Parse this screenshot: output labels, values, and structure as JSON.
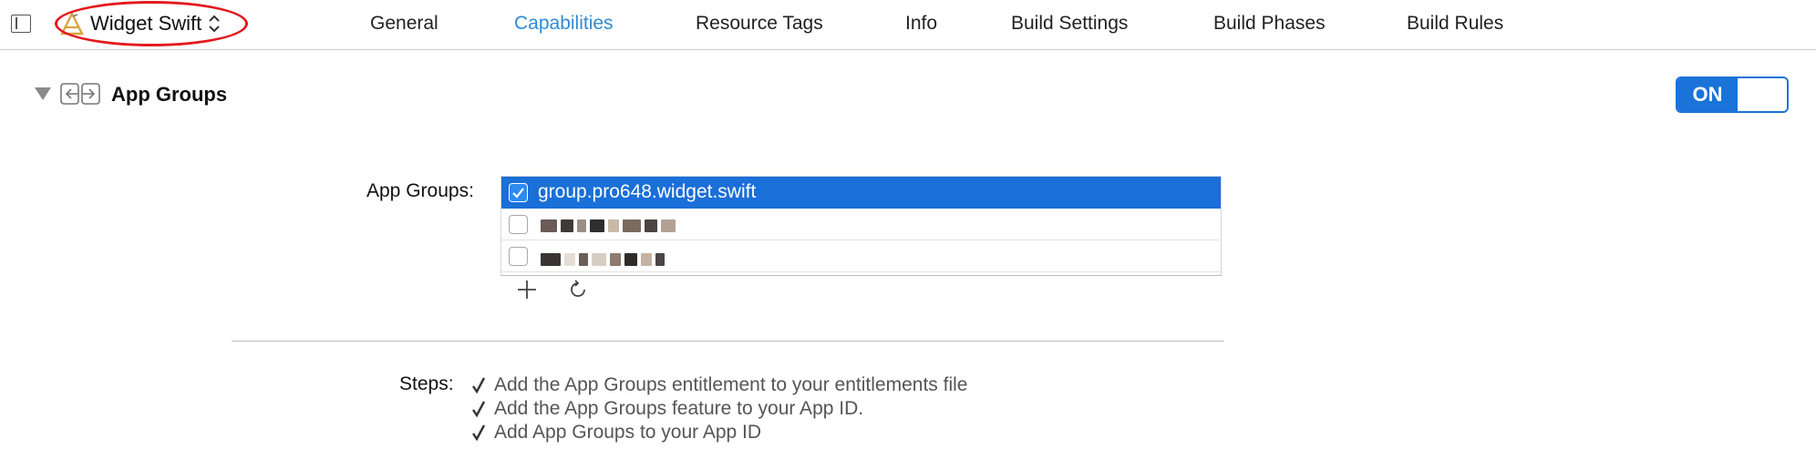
{
  "target": {
    "name": "Widget Swift"
  },
  "tabs": [
    {
      "label": "General",
      "active": false
    },
    {
      "label": "Capabilities",
      "active": true
    },
    {
      "label": "Resource Tags",
      "active": false
    },
    {
      "label": "Info",
      "active": false
    },
    {
      "label": "Build Settings",
      "active": false
    },
    {
      "label": "Build Phases",
      "active": false
    },
    {
      "label": "Build Rules",
      "active": false
    }
  ],
  "section": {
    "title": "App Groups",
    "toggle_label": "ON",
    "toggle_on": true
  },
  "groups": {
    "label": "App Groups:",
    "items": [
      {
        "name": "group.pro648.widget.swift",
        "checked": true,
        "selected": true,
        "redacted": false
      },
      {
        "name": "",
        "checked": false,
        "selected": false,
        "redacted": true
      },
      {
        "name": "",
        "checked": false,
        "selected": false,
        "redacted": true
      }
    ]
  },
  "steps": {
    "label": "Steps:",
    "items": [
      "Add the App Groups entitlement to your entitlements file",
      "Add the App Groups feature to your App ID.",
      "Add App Groups to your App ID"
    ]
  },
  "colors": {
    "accent": "#1a6fd8",
    "active_tab": "#2f8bd6",
    "annotation": "#e4191e"
  },
  "icons": {
    "sidebar_toggle": "sidebar-toggle-icon",
    "target": "app-target-icon",
    "stepper": "stepper-icon",
    "section": "app-groups-icon",
    "add": "plus-icon",
    "refresh": "refresh-icon",
    "step_check": "checkmark-icon"
  }
}
